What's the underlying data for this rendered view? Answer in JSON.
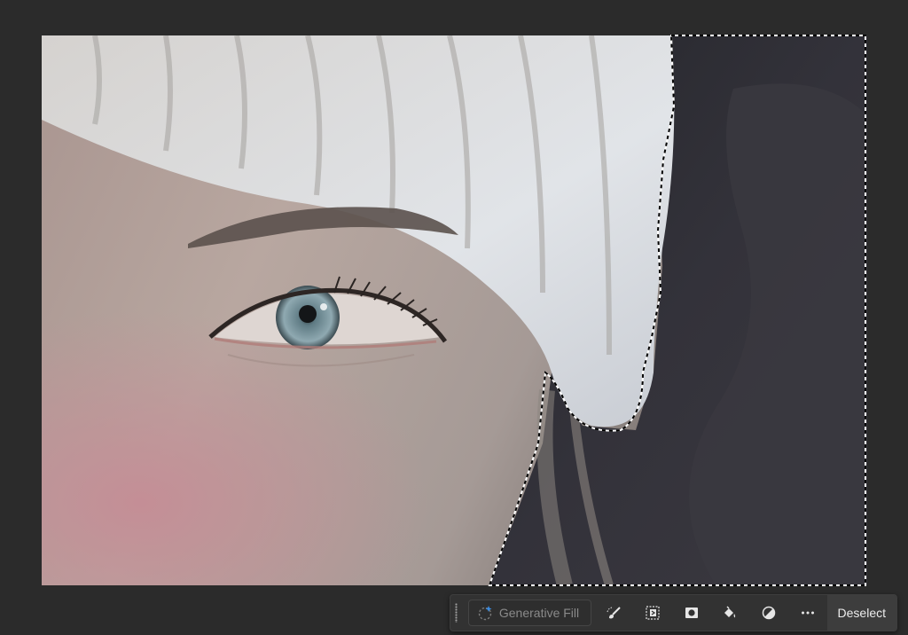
{
  "canvas": {
    "image_subject": "close-up photo of a woman's eye wearing a white knit hat"
  },
  "taskbar": {
    "generative_fill_label": "Generative Fill",
    "tools": [
      {
        "name": "modify-selection-brush-icon"
      },
      {
        "name": "invert-selection-icon"
      },
      {
        "name": "create-mask-icon"
      },
      {
        "name": "fill-selection-icon"
      },
      {
        "name": "adjustment-layer-icon"
      },
      {
        "name": "more-options-icon"
      }
    ],
    "deselect_label": "Deselect"
  },
  "colors": {
    "background": "#2b2b2b",
    "taskbar_bg": "#323232",
    "deselect_bg": "#3d3d3d"
  }
}
